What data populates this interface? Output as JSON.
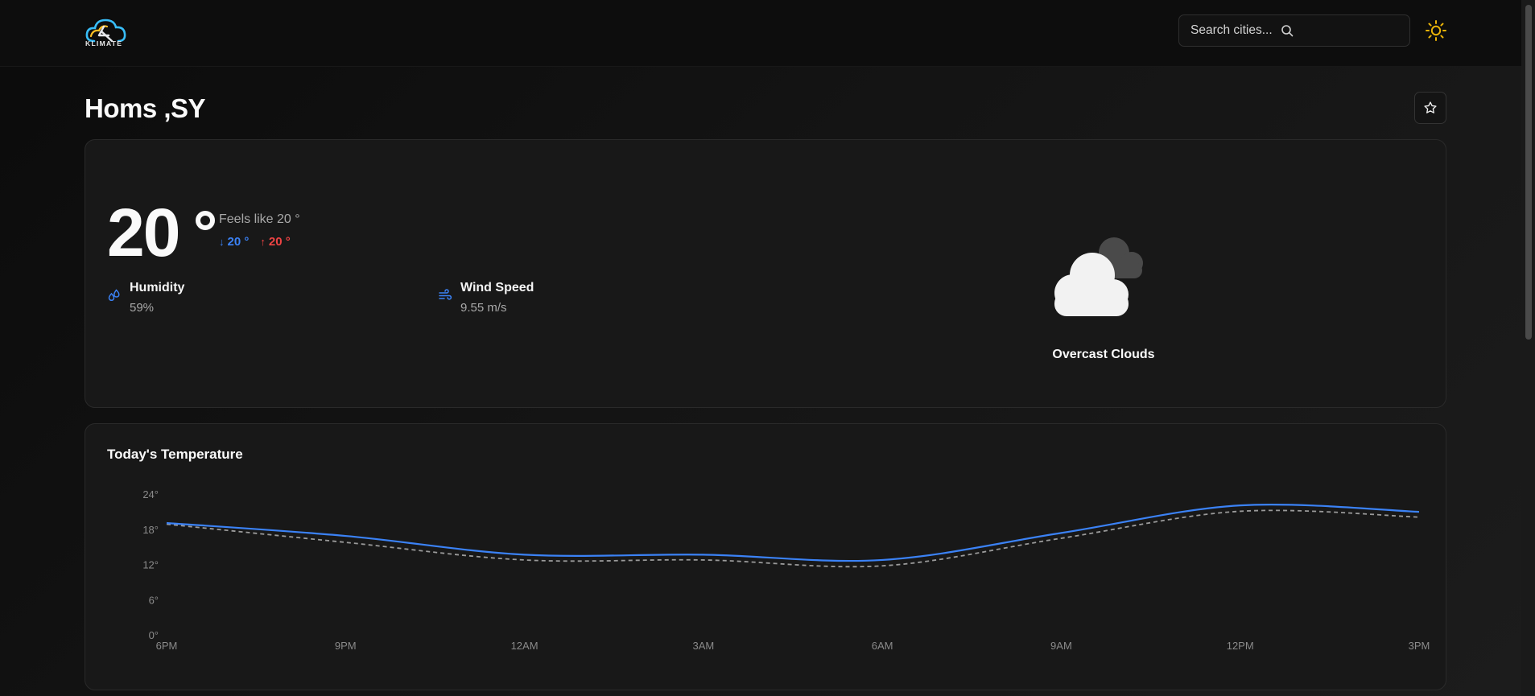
{
  "app": {
    "logo_text": "KLIMATE"
  },
  "header": {
    "search_placeholder": "Search cities..."
  },
  "location": {
    "title": "Homs ,SY"
  },
  "current": {
    "temp": "20",
    "feels_like": "Feels like 20 °",
    "min": "20 °",
    "max": "20 °",
    "humidity_label": "Humidity",
    "humidity_value": "59%",
    "wind_label": "Wind Speed",
    "wind_value": "9.55 m/s",
    "description": "Overcast Clouds"
  },
  "colors": {
    "accent": "#3b82f6",
    "temp_max": "#ef4444",
    "theme_icon": "#eab308",
    "feels_line": "#9a9a9a"
  },
  "chart_data": {
    "type": "line",
    "title": "Today's Temperature",
    "x": [
      "6PM",
      "9PM",
      "12AM",
      "3AM",
      "6AM",
      "9AM",
      "12PM",
      "3PM"
    ],
    "yticks": [
      "0°",
      "6°",
      "12°",
      "18°",
      "24°"
    ],
    "ylim": [
      0,
      24
    ],
    "series": [
      {
        "key": "temp",
        "values": [
          19.2,
          17,
          13.8,
          13.8,
          12.9,
          17.5,
          22.2,
          21.1
        ],
        "color": "#3b82f6",
        "dash": false
      },
      {
        "key": "feels_like",
        "values": [
          19,
          15.9,
          12.9,
          12.9,
          11.9,
          16.6,
          21.2,
          20.2
        ],
        "color": "#9a9a9a",
        "dash": true
      }
    ],
    "legend": false,
    "grid": false
  }
}
